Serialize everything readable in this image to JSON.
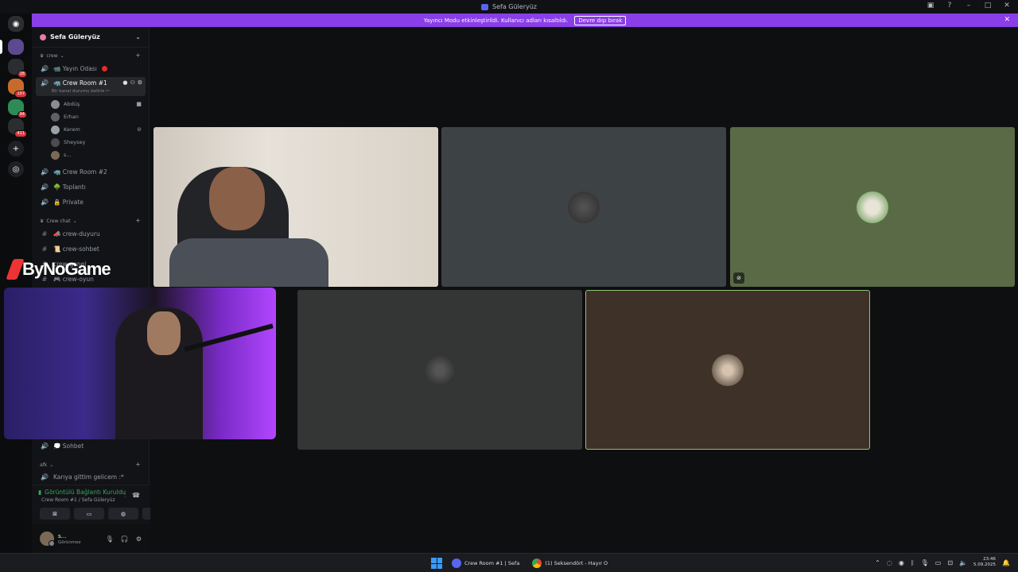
{
  "window": {
    "title": "Sefa Güleryüz"
  },
  "banner": {
    "text": "Yayıncı Modu etkinleştirildi. Kullanıcı adları kısaltıldı.",
    "button": "Devre dışı bırak"
  },
  "rail": {
    "badges": [
      "18",
      "107",
      "94",
      "411"
    ]
  },
  "guild": {
    "name": "Sefa Güleryüz"
  },
  "categories": {
    "crew": "crew",
    "crew_chat": "Crew chat",
    "afk": "afk"
  },
  "channels": {
    "yayin": "📹 Yayın Odası",
    "room1": "🦏 Crew Room #1",
    "room1_status": "Bir kanal durumu belirle ✏",
    "room2": "🦏 Crew Room #2",
    "toplanti": "🌳 Toplantı",
    "private": "🔒 Private",
    "duyuru": "📣 crew-duyuru",
    "sohbet": "📜 crew-sohbet",
    "genel": "crew-genel",
    "oyun": "🎮 crew-oyun",
    "sohbet_voice": "💭 Sohbet",
    "afk_ch": "Karıya gittim gelicem :*"
  },
  "members": [
    "Abdüş",
    "Erhan",
    "Kerem",
    "Sheysey",
    "s..."
  ],
  "voice": {
    "status": "Görüntülü Bağlantı Kuruldu",
    "sub": "Crew Room #1 / Sefa Güleryüz"
  },
  "user": {
    "name": "s...",
    "status": "Görünmez"
  },
  "brand": {
    "text": "ByNoGame"
  },
  "taskbar": {
    "app1": "Crew Room #1 | Sefa",
    "app2": "(1) Seksendört - Hayır O",
    "time": "23:46",
    "date": "5.09.2025"
  },
  "colors": {
    "accent": "#5865f2",
    "banner": "#8a3ee8",
    "connected": "#3ba55c",
    "live": "#e32b2b",
    "speaking_border": "#8fc47a"
  },
  "icons": {
    "voice": "speaker-icon",
    "text": "hash-icon",
    "camera": "camera-icon",
    "mute": "mic-off-icon"
  }
}
